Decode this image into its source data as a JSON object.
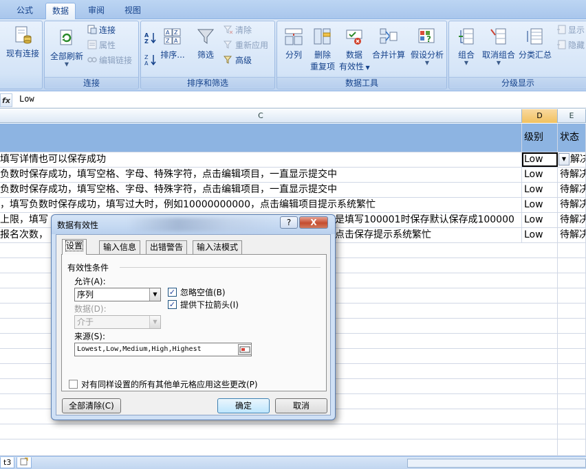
{
  "tabs": [
    "公式",
    "数据",
    "审阅",
    "视图"
  ],
  "ribbon": {
    "existing_connections": "现有连接",
    "refresh_all": "全部刷新",
    "connections": "连接",
    "properties": "属性",
    "edit_links": "编辑链接",
    "group_connections": "连接",
    "sort": "排序...",
    "filter": "筛选",
    "clear": "清除",
    "reapply": "重新应用",
    "advanced": "高级",
    "group_sort_filter": "排序和筛选",
    "text_to_columns": "分列",
    "remove_duplicates_1": "删除",
    "remove_duplicates_2": "重复项",
    "data_validation_1": "数据",
    "data_validation_2": "有效性",
    "consolidate": "合并计算",
    "what_if": "假设分析",
    "group_data_tools": "数据工具",
    "group": "组合",
    "ungroup": "取消组合",
    "subtotal": "分类汇总",
    "show_detail": "显示",
    "hide_detail": "隐藏",
    "group_outline": "分级显示"
  },
  "formula_bar": {
    "fx": "fx",
    "value": "Low"
  },
  "columns": {
    "c": "C",
    "d": "D",
    "e": "E"
  },
  "header_row": {
    "d": "级别",
    "e": "状态"
  },
  "rows": [
    {
      "c": "填写详情也可以保存成功",
      "d": "Low",
      "e": "解决"
    },
    {
      "c": "负数时保存成功，填写空格、字母、特殊字符，点击编辑项目，一直显示提交中",
      "d": "Low",
      "e": "待解决"
    },
    {
      "c": "负数时保存成功，填写空格、字母、特殊字符，点击编辑项目，一直显示提交中",
      "d": "Low",
      "e": "待解决"
    },
    {
      "c": "，填写负数时保存成功，填写过大时，例如10000000000，点击编辑项目提示系统繁忙",
      "d": "Low",
      "e": "待解决"
    },
    {
      "c": "上限，填写",
      "c2": "是填写100001时保存默认保存成100000",
      "d": "Low",
      "e": "待解决"
    },
    {
      "c": "报名次数，",
      "c2": "点击保存提示系统繁忙",
      "d": "Low",
      "e": "待解决"
    }
  ],
  "sheet_tab": {
    "label": "t3"
  },
  "dialog": {
    "title": "数据有效性",
    "help": "?",
    "close": "X",
    "tabs": [
      "设置",
      "输入信息",
      "出错警告",
      "输入法模式"
    ],
    "section": "有效性条件",
    "allow_label": "允许(A):",
    "allow_value": "序列",
    "data_label": "数据(D):",
    "data_value": "介于",
    "ignore_blank": "忽略空值(B)",
    "ignore_blank_checked": true,
    "in_cell_dropdown": "提供下拉箭头(I)",
    "in_cell_dropdown_checked": true,
    "source_label": "来源(S):",
    "source_value": "Lowest,Low,Medium,High,Highest",
    "apply_all": "对有同样设置的所有其他单元格应用这些更改(P)",
    "clear_all": "全部清除(C)",
    "ok": "确定",
    "cancel": "取消"
  },
  "colors": {
    "header_fill": "#8db4e2",
    "ribbon": "#c7daf2",
    "selected_col": "#f1c15f"
  }
}
